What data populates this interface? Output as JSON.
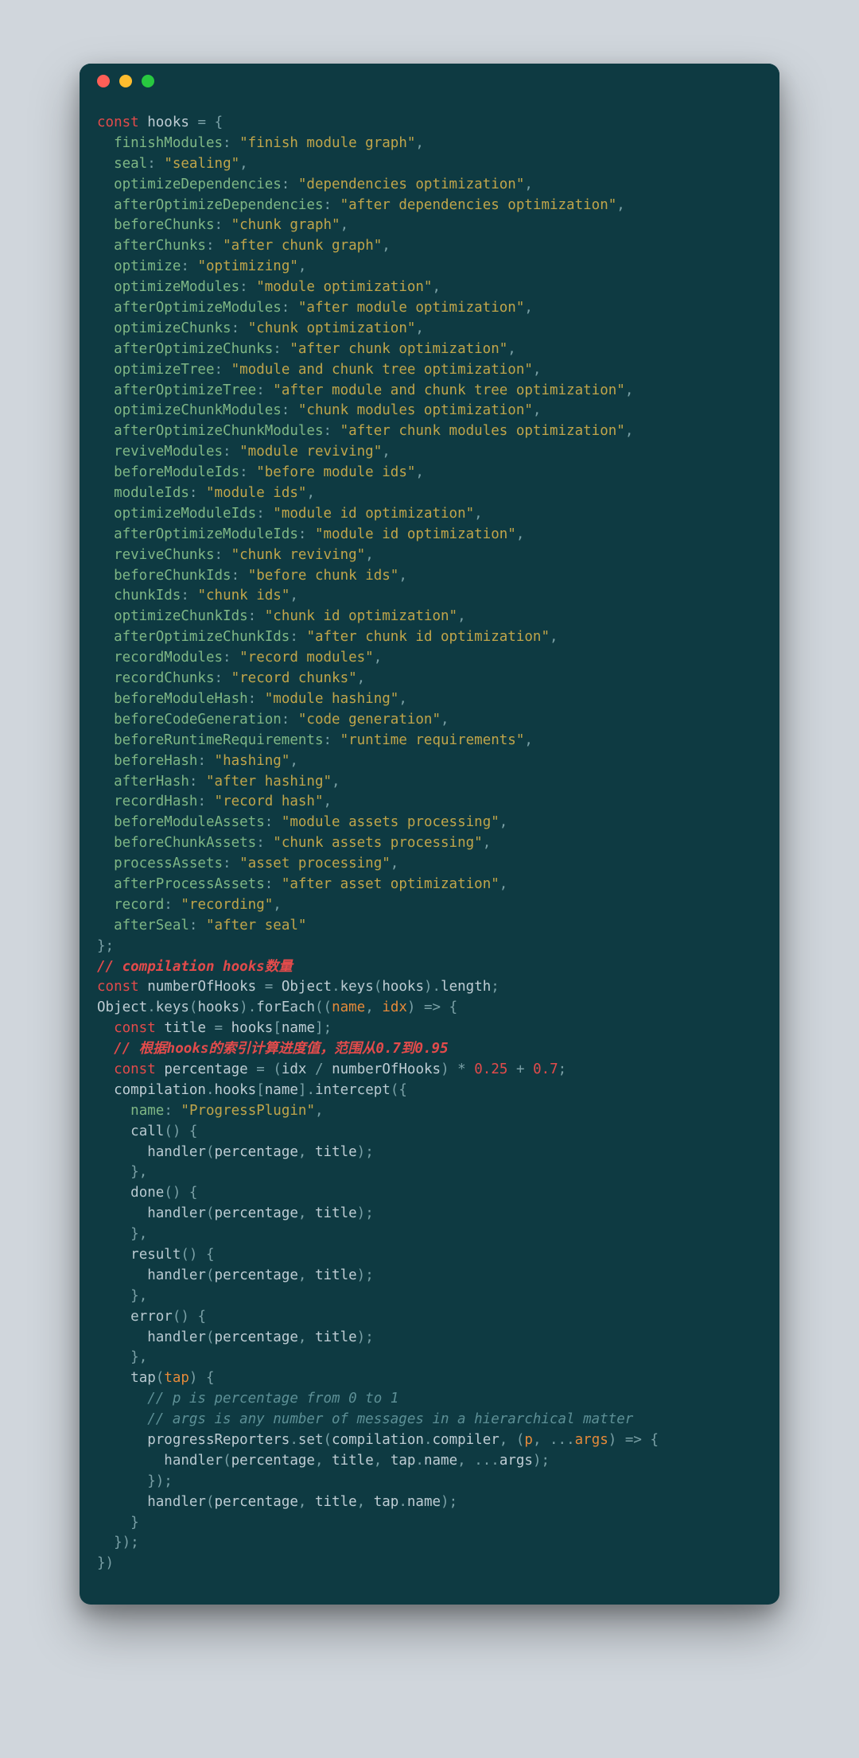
{
  "hooks": [
    {
      "k": "finishModules",
      "v": "finish module graph"
    },
    {
      "k": "seal",
      "v": "sealing"
    },
    {
      "k": "optimizeDependencies",
      "v": "dependencies optimization"
    },
    {
      "k": "afterOptimizeDependencies",
      "v": "after dependencies optimization"
    },
    {
      "k": "beforeChunks",
      "v": "chunk graph"
    },
    {
      "k": "afterChunks",
      "v": "after chunk graph"
    },
    {
      "k": "optimize",
      "v": "optimizing"
    },
    {
      "k": "optimizeModules",
      "v": "module optimization"
    },
    {
      "k": "afterOptimizeModules",
      "v": "after module optimization"
    },
    {
      "k": "optimizeChunks",
      "v": "chunk optimization"
    },
    {
      "k": "afterOptimizeChunks",
      "v": "after chunk optimization"
    },
    {
      "k": "optimizeTree",
      "v": "module and chunk tree optimization"
    },
    {
      "k": "afterOptimizeTree",
      "v": "after module and chunk tree optimization"
    },
    {
      "k": "optimizeChunkModules",
      "v": "chunk modules optimization"
    },
    {
      "k": "afterOptimizeChunkModules",
      "v": "after chunk modules optimization"
    },
    {
      "k": "reviveModules",
      "v": "module reviving"
    },
    {
      "k": "beforeModuleIds",
      "v": "before module ids"
    },
    {
      "k": "moduleIds",
      "v": "module ids"
    },
    {
      "k": "optimizeModuleIds",
      "v": "module id optimization"
    },
    {
      "k": "afterOptimizeModuleIds",
      "v": "module id optimization"
    },
    {
      "k": "reviveChunks",
      "v": "chunk reviving"
    },
    {
      "k": "beforeChunkIds",
      "v": "before chunk ids"
    },
    {
      "k": "chunkIds",
      "v": "chunk ids"
    },
    {
      "k": "optimizeChunkIds",
      "v": "chunk id optimization"
    },
    {
      "k": "afterOptimizeChunkIds",
      "v": "after chunk id optimization"
    },
    {
      "k": "recordModules",
      "v": "record modules"
    },
    {
      "k": "recordChunks",
      "v": "record chunks"
    },
    {
      "k": "beforeModuleHash",
      "v": "module hashing"
    },
    {
      "k": "beforeCodeGeneration",
      "v": "code generation"
    },
    {
      "k": "beforeRuntimeRequirements",
      "v": "runtime requirements"
    },
    {
      "k": "beforeHash",
      "v": "hashing"
    },
    {
      "k": "afterHash",
      "v": "after hashing"
    },
    {
      "k": "recordHash",
      "v": "record hash"
    },
    {
      "k": "beforeModuleAssets",
      "v": "module assets processing"
    },
    {
      "k": "beforeChunkAssets",
      "v": "chunk assets processing"
    },
    {
      "k": "processAssets",
      "v": "asset processing"
    },
    {
      "k": "afterProcessAssets",
      "v": "after asset optimization"
    },
    {
      "k": "record",
      "v": "recording"
    },
    {
      "k": "afterSeal",
      "v": "after seal"
    }
  ],
  "comments": {
    "c1": "// compilation hooks数量",
    "c2": "// 根据hooks的索引计算进度值，范围从0.7到0.95",
    "c3": "// p is percentage from 0 to 1",
    "c4": "// args is any number of messages in a hierarchical matter"
  },
  "tokens": {
    "const": "const",
    "hooksVar": "hooks",
    "numberOfHooks": "numberOfHooks",
    "Object": "Object",
    "keys": "keys",
    "length": "length",
    "forEach": "forEach",
    "name": "name",
    "idx": "idx",
    "title": "title",
    "percentage": "percentage",
    "compilation": "compilation",
    "intercept": "intercept",
    "ProgressPlugin": "\"ProgressPlugin\"",
    "handler": "handler",
    "call": "call",
    "done": "done",
    "result": "result",
    "error": "error",
    "tap": "tap",
    "progressReporters": "progressReporters",
    "set": "set",
    "compiler": "compiler",
    "p": "p",
    "args": "args",
    "n025": "0.25",
    "n07": "0.7"
  }
}
